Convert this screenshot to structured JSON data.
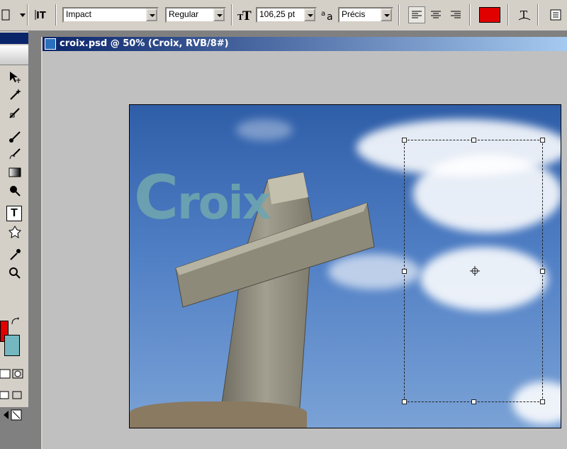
{
  "options_bar": {
    "font_family": "Impact",
    "font_style": "Regular",
    "font_size": "106,25 pt",
    "antialias": "Précis",
    "align_options": [
      "left",
      "center",
      "right"
    ],
    "text_color": "#e00000",
    "icons": [
      "text-orientation-icon",
      "font-size-icon",
      "antialias-icon",
      "align-left-icon",
      "align-center-icon",
      "align-right-icon",
      "warp-text-icon",
      "palettes-icon"
    ]
  },
  "toolbox": {
    "tools": [
      "move-tool",
      "magic-wand-tool",
      "slice-tool",
      "brush-tool",
      "clone-stamp-tool",
      "gradient-tool",
      "dodge-tool",
      "type-tool",
      "custom-shape-tool",
      "eyedropper-tool",
      "zoom-tool"
    ],
    "active_tool": "type-tool",
    "foreground_color": "#e00000",
    "background_color": "#74b7c0"
  },
  "document": {
    "title": "croix.psd @ 50% (Croix, RVB/8#)",
    "canvas_text_first": "C",
    "canvas_text_rest": "roix",
    "text_color": "#6fa5b0"
  }
}
